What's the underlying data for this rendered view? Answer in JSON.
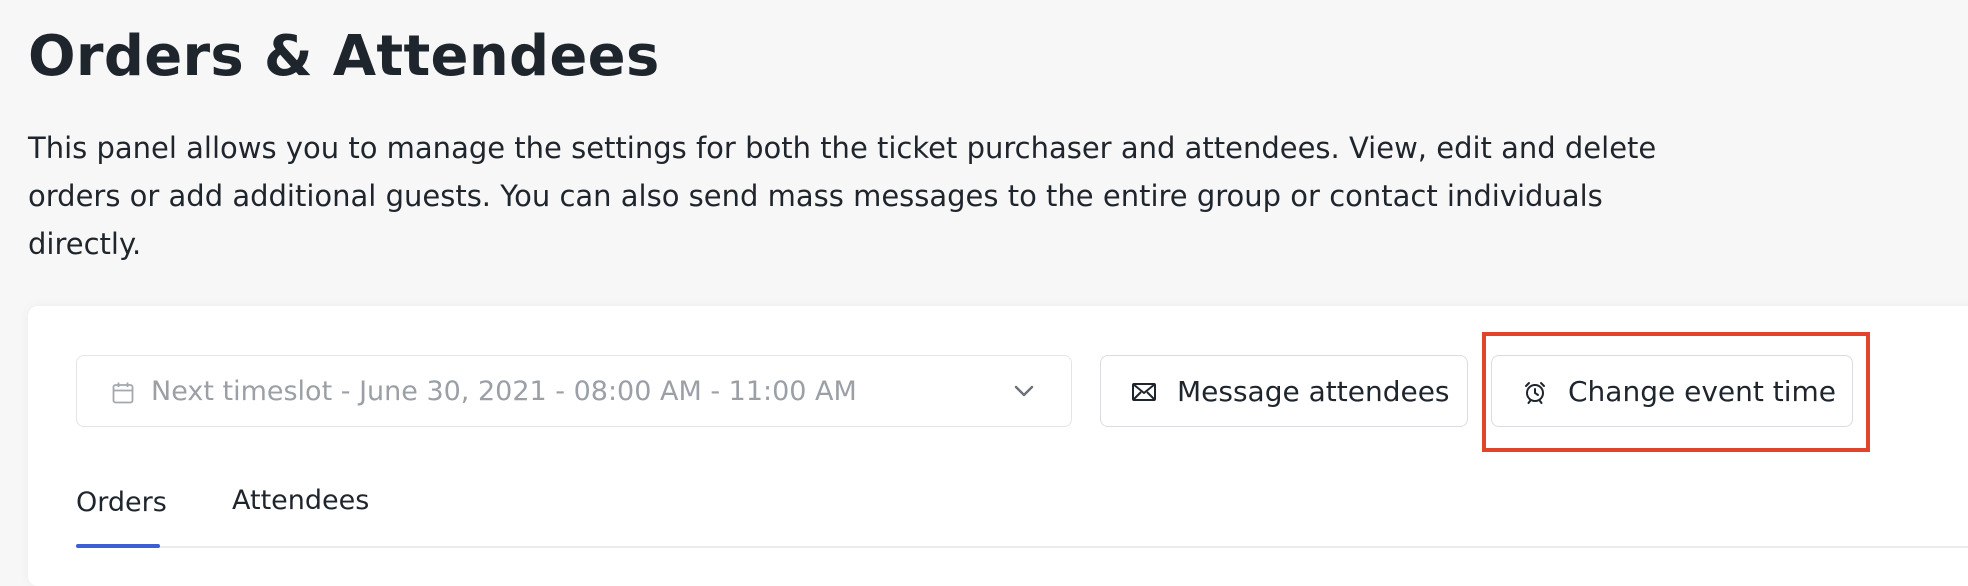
{
  "header": {
    "title": "Orders & Attendees",
    "description": "This panel allows you to manage the settings for both the ticket purchaser and attendees. View, edit and delete orders or add additional guests. You can also send mass messages to the entire group or contact individuals directly."
  },
  "toolbar": {
    "timeslot": {
      "selected": "Next timeslot - June 30, 2021 - 08:00 AM - 11:00 AM",
      "icon": "calendar-icon",
      "dropdown_icon": "chevron-down-icon"
    },
    "message_button": {
      "label": "Message attendees",
      "icon": "envelope-icon"
    },
    "change_time_button": {
      "label": "Change event time",
      "icon": "alarm-clock-icon"
    },
    "highlight_color": "#e0442b"
  },
  "tabs": [
    {
      "label": "Orders",
      "active": true
    },
    {
      "label": "Attendees",
      "active": false
    }
  ],
  "colors": {
    "accent": "#3c5fd6",
    "background": "#f7f7f7",
    "text": "#1f252c",
    "muted": "#9aa0a6"
  }
}
